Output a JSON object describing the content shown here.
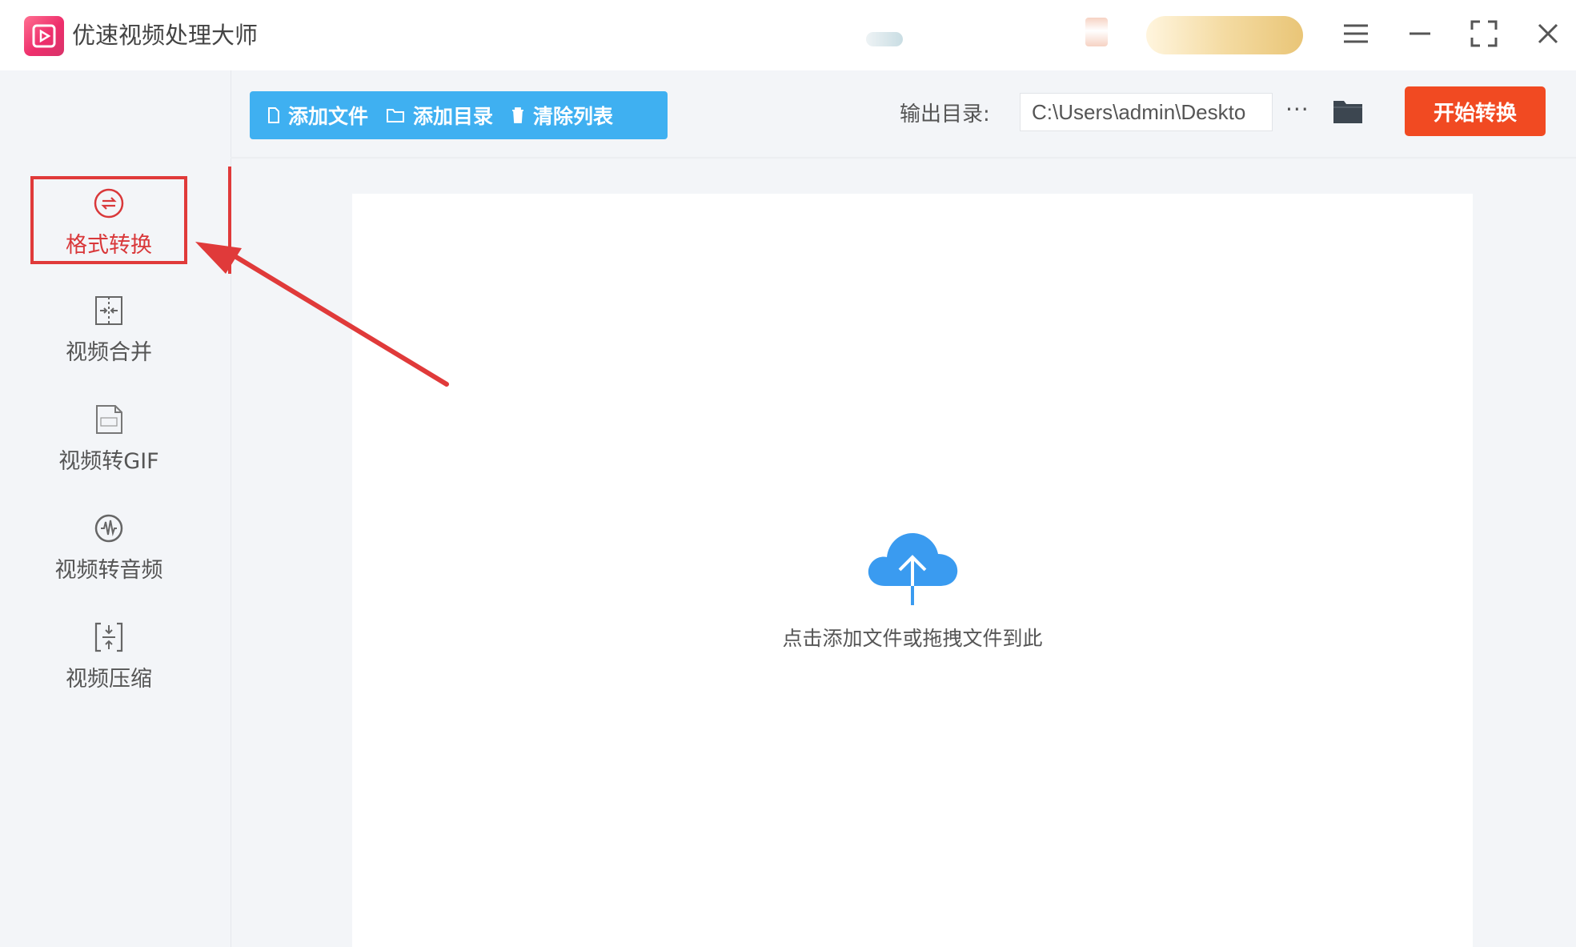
{
  "app": {
    "title": "优速视频处理大师"
  },
  "sidebar": {
    "items": [
      {
        "label": "格式转换",
        "icon": "format-convert-icon",
        "active": true
      },
      {
        "label": "视频合并",
        "icon": "video-merge-icon",
        "active": false
      },
      {
        "label": "视频转GIF",
        "icon": "video-to-gif-icon",
        "active": false
      },
      {
        "label": "视频转音频",
        "icon": "video-to-audio-icon",
        "active": false
      },
      {
        "label": "视频压缩",
        "icon": "video-compress-icon",
        "active": false
      }
    ]
  },
  "toolbar": {
    "add_file": "添加文件",
    "add_folder": "添加目录",
    "clear_list": "清除列表",
    "output_label": "输出目录:",
    "output_path": "C:\\Users\\admin\\Deskto",
    "more": "···",
    "start": "开始转换"
  },
  "main": {
    "drop_hint": "点击添加文件或拖拽文件到此"
  },
  "colors": {
    "accent_blue": "#3fb0f1",
    "start_red": "#f14a22",
    "highlight_red": "#e03a3a",
    "cloud_blue": "#3a9bf0"
  }
}
